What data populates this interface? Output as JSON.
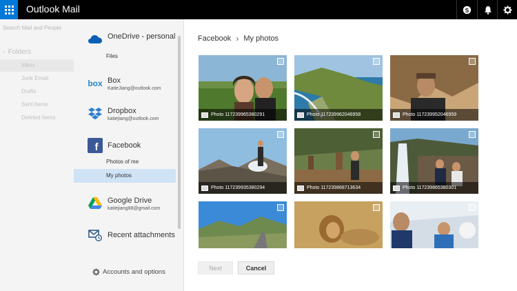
{
  "header": {
    "app_title": "Outlook Mail",
    "waffle_icon": "app-launcher-icon",
    "skype_icon": "skype-icon",
    "bell_icon": "bell-icon",
    "gear_icon": "gear-icon"
  },
  "background": {
    "search_placeholder": "Search Mail and People",
    "folders_label": "Folders",
    "folders": [
      "Inbox",
      "Junk Email",
      "Drafts",
      "Sent Items",
      "Deleted Items"
    ]
  },
  "nav": {
    "onedrive": {
      "name": "OneDrive - personal",
      "sub": "Files"
    },
    "box": {
      "name": "Box",
      "account": "KatieJiang@outlook.com"
    },
    "dropbox": {
      "name": "Dropbox",
      "account": "katiejiang@outlook.com"
    },
    "facebook": {
      "name": "Facebook",
      "items": [
        "Photos of me",
        "My photos"
      ]
    },
    "google": {
      "name": "Google Drive",
      "account": "katiejiang88@gmail.com"
    },
    "recent": {
      "name": "Recent attachments"
    },
    "accounts_label": "Accounts and options"
  },
  "breadcrumb": {
    "root": "Facebook",
    "current": "My photos"
  },
  "photos": [
    {
      "caption": "Photo 117239965380291"
    },
    {
      "caption": "Photo 117239962046958"
    },
    {
      "caption": "Photo 117239952046959"
    },
    {
      "caption": "Photo 117239935380294"
    },
    {
      "caption": "Photo 117239868713634"
    },
    {
      "caption": "Photo 117239865380301"
    },
    {
      "caption": ""
    },
    {
      "caption": ""
    },
    {
      "caption": ""
    }
  ],
  "buttons": {
    "next": "Next",
    "cancel": "Cancel"
  },
  "colors": {
    "accent": "#0078d7",
    "selected": "#cfe3f5"
  }
}
